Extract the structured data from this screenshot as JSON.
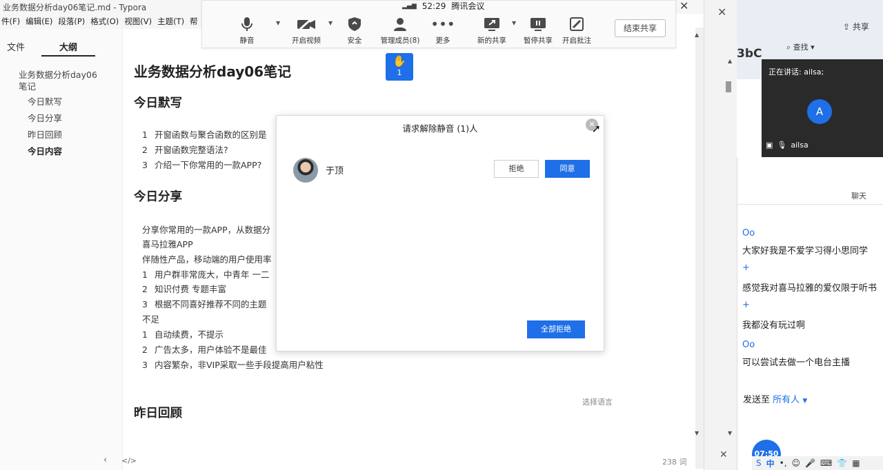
{
  "typora": {
    "window_title": "业务数据分析day06笔记.md - Typora",
    "menu": [
      "件(F)",
      "编辑(E)",
      "段落(P)",
      "格式(O)",
      "视图(V)",
      "主题(T)",
      "帮"
    ]
  },
  "sidebar": {
    "tab_files": "文件",
    "tab_outline": "大纲",
    "outline": [
      "业务数据分析day06笔记",
      "今日默写",
      "今日分享",
      "昨日回顾",
      "今日内容"
    ],
    "back_icon": "‹",
    "source_icon": "</>"
  },
  "document": {
    "title": "业务数据分析day06笔记",
    "h_dictation": "今日默写",
    "dictation": [
      {
        "n": "1",
        "text": "开窗函数与聚合函数的区别是"
      },
      {
        "n": "2",
        "text": "开窗函数完整语法?"
      },
      {
        "n": "3",
        "text": "介绍一下你常用的一款APP?"
      }
    ],
    "h_share": "今日分享",
    "share_intro": "分享你常用的一款APP，从数据分",
    "share_app": "喜马拉雅APP",
    "share_context": "伴随性产品，移动端的用户使用率",
    "advantages": [
      {
        "n": "1",
        "text": "用户群非常庞大，中青年  一二"
      },
      {
        "n": "2",
        "text": "知识付费  专题丰富"
      },
      {
        "n": "3",
        "text": "根据不同喜好推荐不同的主题"
      }
    ],
    "shortcomings_label": "不足",
    "shortcomings": [
      {
        "n": "1",
        "text": "自动续费，不提示"
      },
      {
        "n": "2",
        "text": "广告太多，用户体验不是最佳"
      },
      {
        "n": "3",
        "text": "内容繁杂，非VIP采取一些手段提高用户粘性"
      }
    ],
    "lang_select": "选择语言",
    "h_review": "昨日回顾",
    "word_count": "238 词"
  },
  "meeting": {
    "app_name": "腾讯会议",
    "time": "52:29",
    "tools": {
      "mute": "静音",
      "video": "开启视频",
      "security": "安全",
      "members": "管理成员(8)",
      "more": "更多",
      "new_share": "新的共享",
      "pause_share": "暂停共享",
      "annotate": "开启批注"
    },
    "end_share": "结束共享",
    "raised_hands": "1"
  },
  "unmute_modal": {
    "title": "请求解除静音 (1)人",
    "requester": "于顶",
    "reject": "拒绝",
    "agree": "同意",
    "reject_all": "全部拒绝"
  },
  "word_window": {
    "share": "共享",
    "find": "查找",
    "bbc": "3bC"
  },
  "video_tile": {
    "speaking": "正在讲话: ailsa;",
    "avatar_letter": "A",
    "name": "ailsa"
  },
  "chat": {
    "title": "聊天",
    "messages": [
      {
        "sender": "Oo",
        "text": "大家好我是不爱学习得小思同学"
      },
      {
        "sender": "+",
        "text": "感觉我对喜马拉雅的爱仅限于听书"
      },
      {
        "sender": "+",
        "text": "我都没有玩过啊"
      },
      {
        "sender": "Oo",
        "text": "可以尝试去做一个电台主播"
      }
    ],
    "send_to_label": "发送至",
    "recipient": "所有人"
  },
  "taskbar": {
    "clock": "07:50",
    "ime": "中"
  },
  "colors": {
    "accent_blue": "#1e6fe8",
    "video_bg": "#2a2a2a"
  }
}
